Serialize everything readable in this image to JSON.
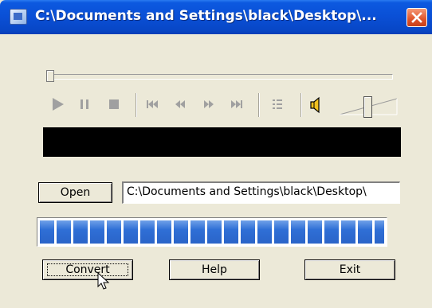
{
  "window": {
    "title": "C:\\Documents and Settings\\black\\Desktop\\...",
    "close_icon": "close-icon"
  },
  "player": {
    "seek_position": 0,
    "volume_level": 0.5,
    "controls": [
      "play-icon",
      "pause-icon",
      "stop-icon",
      "skip-back-icon",
      "rewind-icon",
      "fast-forward-icon",
      "skip-forward-icon",
      "playlist-icon",
      "speaker-icon"
    ]
  },
  "open_button": {
    "label": "Open"
  },
  "path_field": {
    "value": "C:\\Documents and Settings\\black\\Desktop\\"
  },
  "progress": {
    "value": 1.0,
    "color": "#2f6fd6"
  },
  "buttons": {
    "convert": "Convert",
    "help": "Help",
    "exit": "Exit"
  }
}
